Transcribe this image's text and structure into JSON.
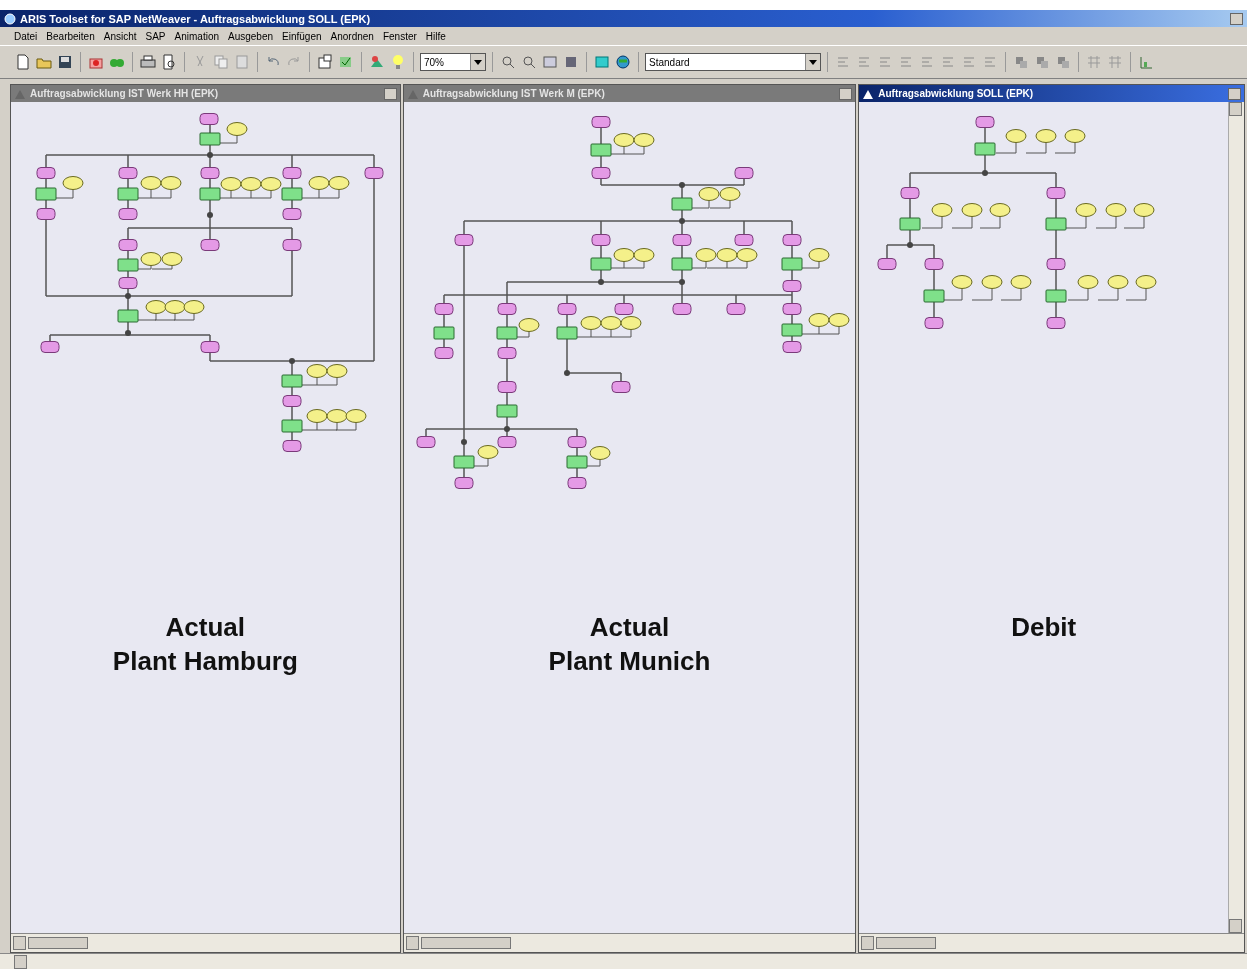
{
  "window": {
    "title": "ARIS Toolset for SAP NetWeaver - Auftragsabwicklung SOLL (EPK)"
  },
  "menu": [
    "Datei",
    "Bearbeiten",
    "Ansicht",
    "SAP",
    "Animation",
    "Ausgeben",
    "Einfügen",
    "Anordnen",
    "Fenster",
    "Hilfe"
  ],
  "toolbar": {
    "zoom": "70%",
    "style": "Standard"
  },
  "panes": [
    {
      "title": "Auftragsabwicklung IST Werk HH (EPK)",
      "active": false,
      "caption_lines": [
        "Actual",
        "Plant Hamburg"
      ]
    },
    {
      "title": "Auftragsabwicklung IST Werk M (EPK)",
      "active": false,
      "caption_lines": [
        "Actual",
        "Plant Munich"
      ]
    },
    {
      "title": "Auftragsabwicklung SOLL (EPK)",
      "active": true,
      "caption_lines": [
        "Debit"
      ]
    }
  ]
}
